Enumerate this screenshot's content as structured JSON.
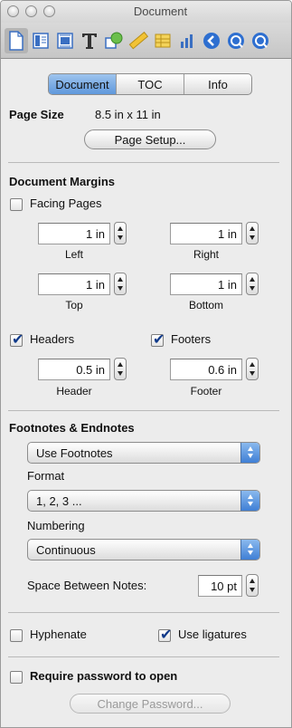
{
  "window": {
    "title": "Document"
  },
  "toolbar": {
    "icons": [
      "document-icon",
      "layout-icon",
      "wrap-icon",
      "text-icon",
      "graphic-icon",
      "metrics-icon",
      "table-icon",
      "chart-icon",
      "link-icon",
      "quicktime-icon"
    ]
  },
  "tabs": {
    "document": "Document",
    "toc": "TOC",
    "info": "Info"
  },
  "page": {
    "size_label": "Page Size",
    "size_value": "8.5 in x 11 in",
    "setup_button": "Page Setup..."
  },
  "margins": {
    "heading": "Document Margins",
    "facing_pages": "Facing Pages",
    "left": {
      "value": "1 in",
      "label": "Left"
    },
    "right": {
      "value": "1 in",
      "label": "Right"
    },
    "top": {
      "value": "1 in",
      "label": "Top"
    },
    "bottom": {
      "value": "1 in",
      "label": "Bottom"
    },
    "headers_label": "Headers",
    "footers_label": "Footers",
    "header": {
      "value": "0.5 in",
      "label": "Header"
    },
    "footer": {
      "value": "0.6 in",
      "label": "Footer"
    }
  },
  "notes": {
    "heading": "Footnotes & Endnotes",
    "type_selected": "Use Footnotes",
    "format_label": "Format",
    "format_selected": "1, 2, 3 ...",
    "numbering_label": "Numbering",
    "numbering_selected": "Continuous",
    "space_label": "Space Between Notes:",
    "space_value": "10 pt"
  },
  "options": {
    "hyphenate": "Hyphenate",
    "ligatures": "Use ligatures"
  },
  "security": {
    "require_password": "Require password to open",
    "change_password": "Change Password..."
  },
  "colors": {
    "accent": "#5f98dc",
    "check": "#103a8a"
  }
}
